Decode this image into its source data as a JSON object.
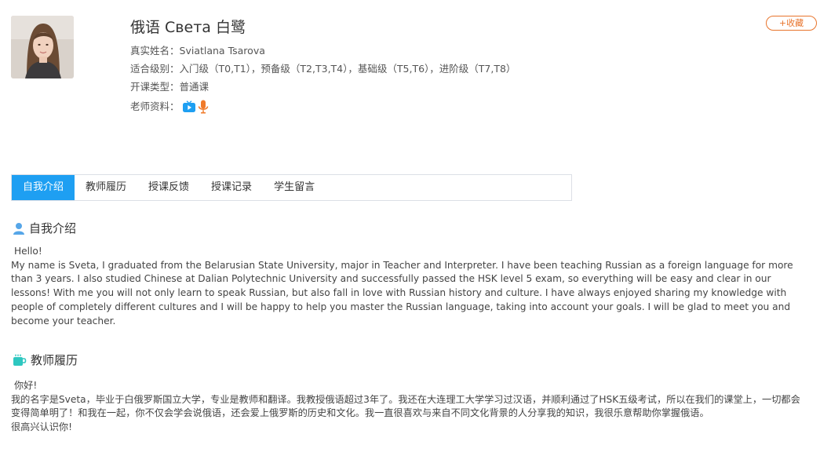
{
  "profile": {
    "name": "俄语 Света 白鹭",
    "realname_label": "真实姓名：",
    "realname": "Sviatlana Tsarova",
    "levels_label": "适合级别：",
    "levels": "入门级（T0,T1），预备级（T2,T3,T4），基础级（T5,T6），进阶级（T7,T8）",
    "course_label": "开课类型：",
    "course": "普通课",
    "materials_label": "老师资料：",
    "icons": [
      "video-icon",
      "microphone-icon"
    ]
  },
  "favorite_label": "+收藏",
  "tabs": [
    {
      "label": "自我介绍",
      "active": true
    },
    {
      "label": "教师履历",
      "active": false
    },
    {
      "label": "授课反馈",
      "active": false
    },
    {
      "label": "授课记录",
      "active": false
    },
    {
      "label": "学生留言",
      "active": false
    }
  ],
  "intro": {
    "title": "自我介绍",
    "greeting": "Hello!",
    "text": "My name is Sveta, I graduated from the Belarusian State University, major in Teacher and Interpreter. I have been teaching Russian as a foreign language for more than 3 years. I also studied Chinese at Dalian Polytechnic University and successfully passed the HSK level 5 exam, so everything will be easy and clear in our lessons! With me you will not only learn to speak Russian, but also fall in love with Russian history and culture. I have always enjoyed sharing my knowledge with people of completely different cultures and I will be happy to help you master the Russian language, taking into account your goals. I will be glad to meet you and become your teacher."
  },
  "resume": {
    "title": "教师履历",
    "greeting": "你好!",
    "text": "我的名字是Sveta，毕业于白俄罗斯国立大学，专业是教师和翻译。我教授俄语超过3年了。我还在大连理工大学学习过汉语，并顺利通过了HSK五级考试，所以在我们的课堂上，一切都会变得简单明了！和我在一起，你不仅会学会说俄语，还会爱上俄罗斯的历史和文化。我一直很喜欢与来自不同文化背景的人分享我的知识，我很乐意帮助你掌握俄语。",
    "closing": "很高兴认识你!"
  },
  "colors": {
    "accent": "#1e9ff2",
    "favorite": "#e8742c",
    "video": "#1e9ff2",
    "mic": "#f07a2a",
    "resume_icon": "#2ec7c0"
  }
}
